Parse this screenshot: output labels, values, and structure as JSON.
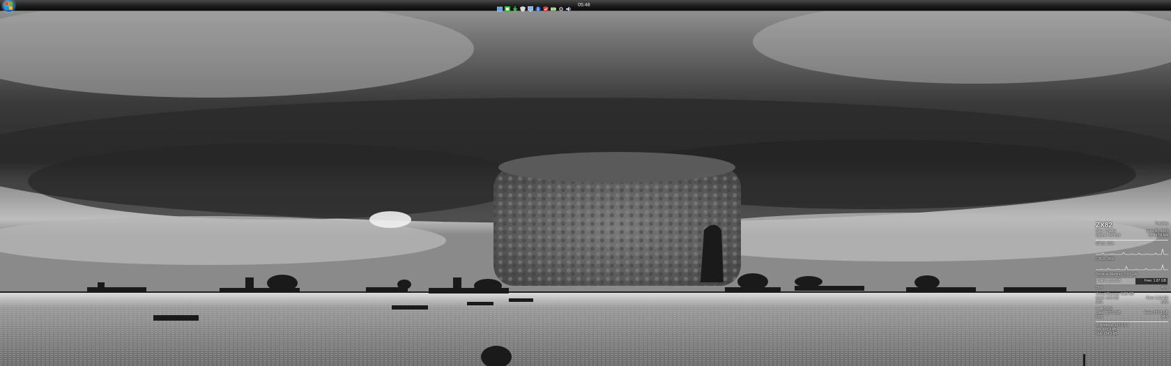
{
  "taskbar": {
    "clock": "05:48",
    "tray_icons": [
      "network-icon",
      "green-app-icon",
      "download-icon",
      "shield-icon",
      "monitor-icon",
      "info-icon",
      "security-icon",
      "power-icon",
      "settings-icon",
      "volume-icon"
    ]
  },
  "gadget": {
    "hostname": "ZX82",
    "day": "Tuesday",
    "user": "User: Charlie",
    "date": "June 30, 2009",
    "uptime": "Uptime: 8d 5:15",
    "time": "05:48:58 AM",
    "cpu1": {
      "label": "CPU1: 21%",
      "percent": 21
    },
    "cpu2": {
      "label": "CPU2: 28%",
      "percent": 28
    },
    "physical": {
      "label": "Physical Memory: 3.87 GB",
      "used": "Used: 2.12 GB",
      "free": "Free: 1.87 GB",
      "used_pct": "55%",
      "free_pct": "45%",
      "percent": 55
    },
    "virtual": {
      "label": "Virtual Memory: 8.22 GB",
      "used": "Used: 3.00 GB",
      "free": "Free: 5.22 GB",
      "used_pct": "36%",
      "free_pct": "63%",
      "percent": 36
    },
    "disk": {
      "label": "C: 465.8 G",
      "used": "Used: 307.9 GB",
      "free": "Free: 157.9 GB",
      "used_pct": "66%",
      "free_pct": "34%",
      "percent": 66
    },
    "net": {
      "ip": "IP Address: 127.0.0.1",
      "inbound": "Inb: 177.9 kB",
      "outbound": "Out: 154.1 kB"
    }
  }
}
